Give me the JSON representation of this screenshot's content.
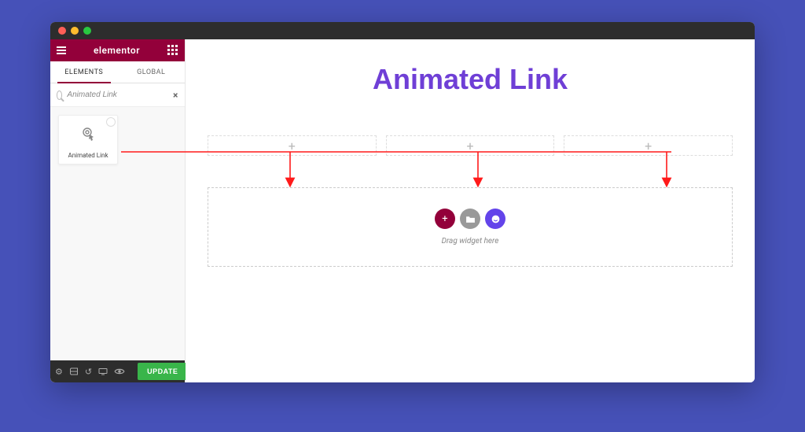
{
  "sidebar": {
    "brand": "elementor",
    "tabs": {
      "elements": "ELEMENTS",
      "global": "GLOBAL"
    },
    "search": {
      "placeholder": "Animated Link",
      "value": "Animated Link"
    },
    "widget": {
      "label": "Animated Link"
    },
    "footer": {
      "update": "UPDATE"
    }
  },
  "canvas": {
    "title": "Animated Link",
    "drop_hint": "Drag widget here"
  }
}
